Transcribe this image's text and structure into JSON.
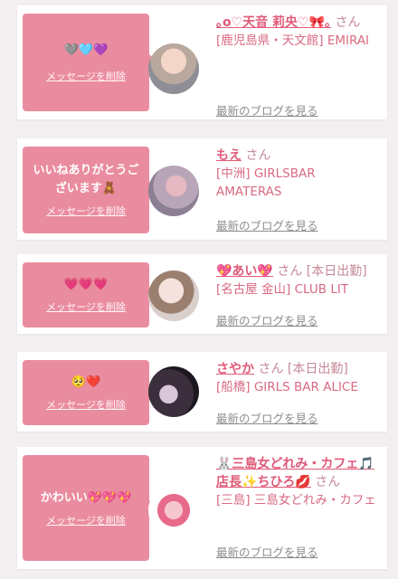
{
  "entries": [
    {
      "message": "🩶🩵💜",
      "delete_label": "メッセージを削除",
      "name": "｡o♡天音 莉央♡🎀｡",
      "honorific": "さん",
      "status": "",
      "shop": "[鹿児島県・天文館] EMIRAI",
      "blog_label": "最新のブログを見る"
    },
    {
      "message": "いいねありがとうございます🧸",
      "delete_label": "メッセージを削除",
      "name": "もえ",
      "honorific": "さん",
      "status": "",
      "shop": "[中洲] GIRLSBAR AMATERAS",
      "blog_label": "最新のブログを見る"
    },
    {
      "message": "💗💗💗",
      "delete_label": "メッセージを削除",
      "name": "💖あい💖",
      "honorific": "さん",
      "status": "[本日出勤]",
      "shop": "[名古屋 金山] CLUB LIT",
      "blog_label": "最新のブログを見る"
    },
    {
      "message": "🥺❤️",
      "delete_label": "メッセージを削除",
      "name": "さやか",
      "honorific": "さん",
      "status": "[本日出勤]",
      "shop": "[船橋] GIRLS BAR ALICE",
      "blog_label": "最新のブログを見る"
    },
    {
      "message": "かわいい💖💖💖",
      "delete_label": "メッセージを削除",
      "name": "🐰三島女どれみ・カフェ🎵店長✨ちひろ💋",
      "honorific": "さん",
      "status": "",
      "shop": "[三島] 三島女どれみ・カフェ",
      "blog_label": "最新のブログを見る"
    }
  ]
}
